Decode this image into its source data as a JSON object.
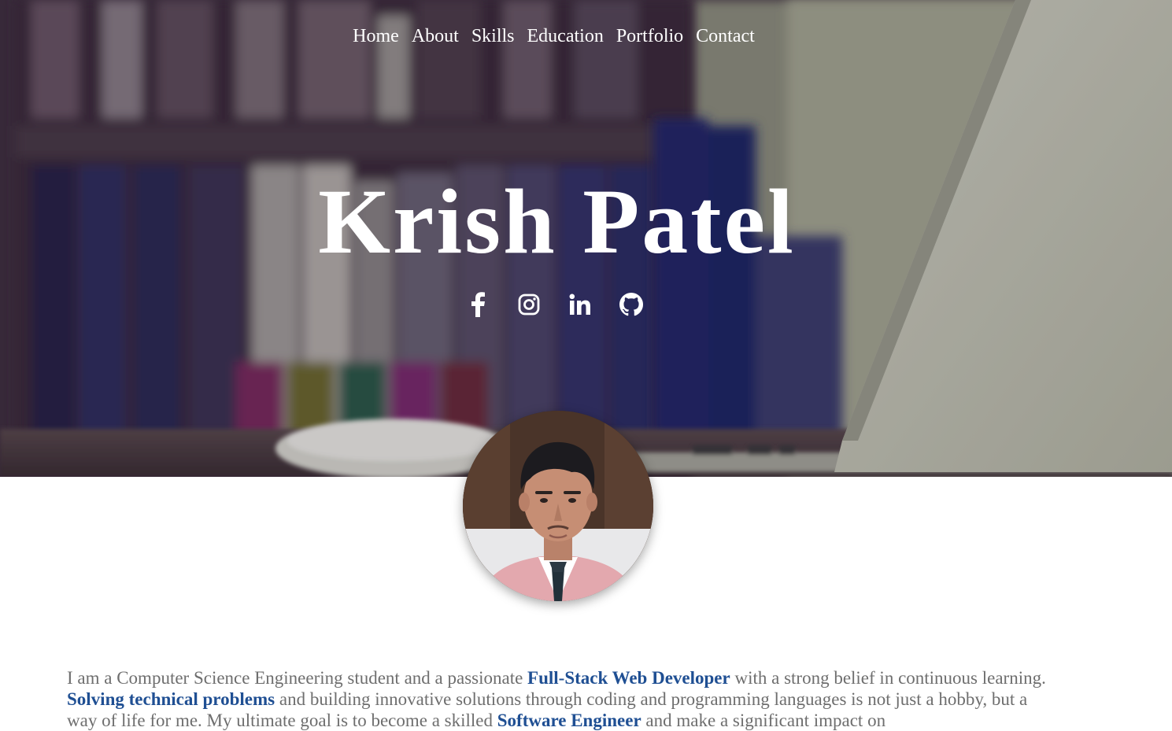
{
  "nav": {
    "items": [
      {
        "label": "Home"
      },
      {
        "label": "About"
      },
      {
        "label": "Skills"
      },
      {
        "label": "Education"
      },
      {
        "label": "Portfolio"
      },
      {
        "label": "Contact"
      }
    ]
  },
  "hero": {
    "name": "Krish Patel",
    "socials": [
      {
        "icon": "facebook-icon"
      },
      {
        "icon": "instagram-icon"
      },
      {
        "icon": "linkedin-icon"
      },
      {
        "icon": "github-icon"
      }
    ]
  },
  "about": {
    "parts": [
      "I am a Computer Science Engineering student and a passionate ",
      "Full-Stack Web Developer",
      " with a strong belief in continuous learning. ",
      "Solving technical problems",
      " and building innovative solutions through coding and programming languages is not just a hobby, but a way of life for me. My ultimate goal is to become a skilled ",
      "Software Engineer",
      " and make a significant impact on"
    ]
  },
  "colors": {
    "highlight": "#1f4f93",
    "body_text": "#6e6e6e",
    "nav_text": "#ffffff"
  }
}
